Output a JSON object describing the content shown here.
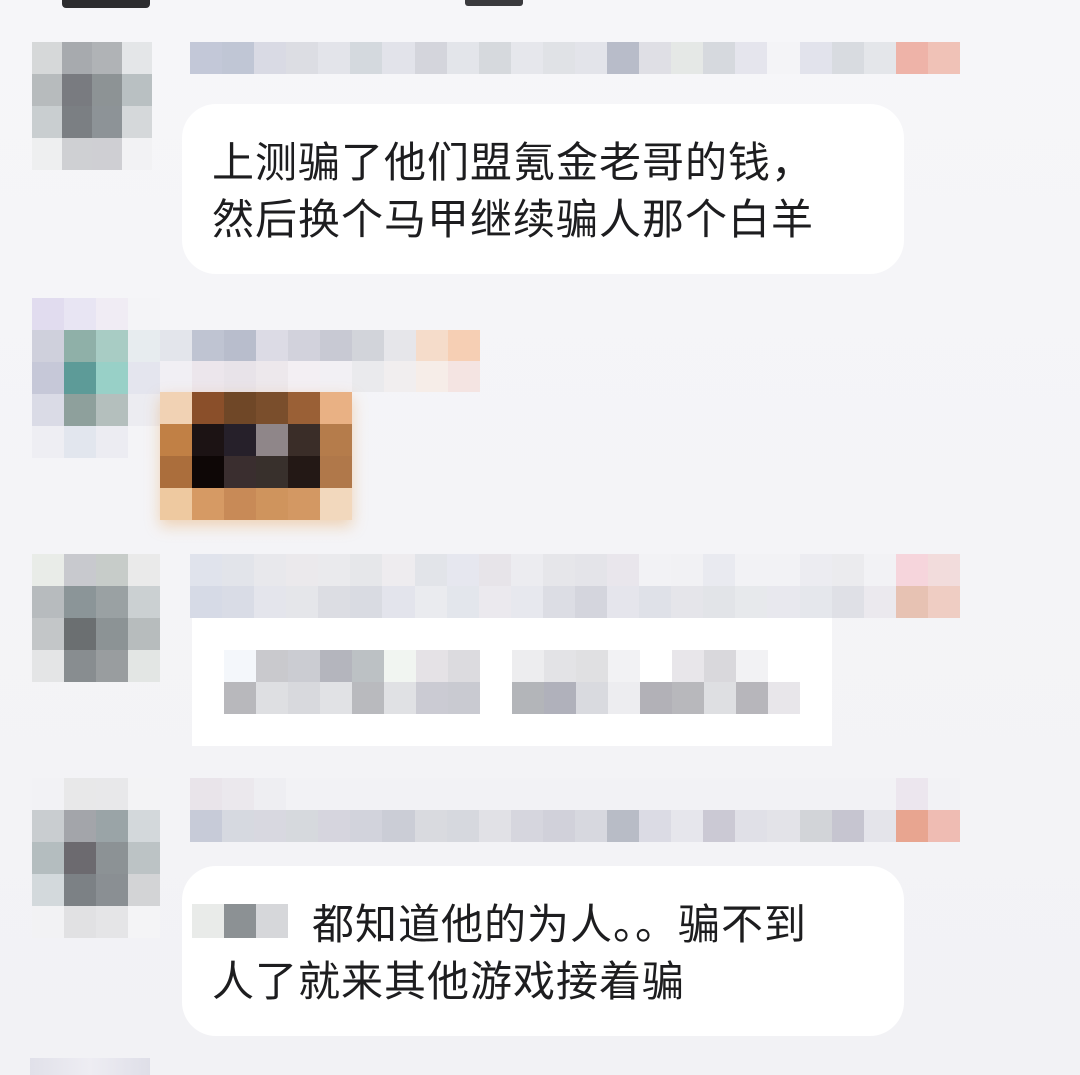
{
  "chat": {
    "messages": [
      {
        "lines": [
          "上测骗了他们盟氪金老哥的钱，",
          "然后换个马甲继续骗人那个白羊"
        ]
      },
      {
        "type": "sticker"
      },
      {
        "type": "redacted"
      },
      {
        "lines": [
          "都知道他的为人。。骗不到",
          "人了就来其他游戏接着骗"
        ]
      }
    ]
  },
  "colors": {
    "background": "#f4f4f7",
    "bubble": "#ffffff",
    "text": "#1d1d1f"
  }
}
